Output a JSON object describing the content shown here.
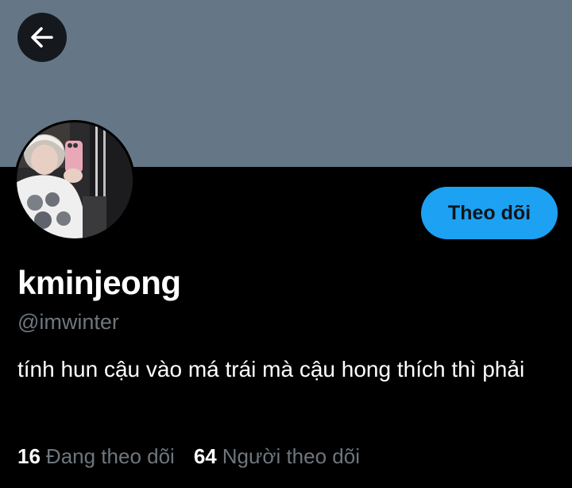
{
  "profile": {
    "display_name": "kminjeong",
    "handle": "@imwinter",
    "bio": "tính hun cậu vào má trái mà cậu hong thích thì phải",
    "avatar_desc": "avatar"
  },
  "actions": {
    "follow_label": "Theo dõi",
    "back_icon": "arrow-left-icon"
  },
  "stats": {
    "following_count": "16",
    "following_label": "Đang theo dõi",
    "followers_count": "64",
    "followers_label": "Người theo dõi"
  },
  "colors": {
    "banner": "#657786",
    "background": "#000000",
    "accent": "#1da1f2",
    "muted_text": "#6e767d"
  }
}
